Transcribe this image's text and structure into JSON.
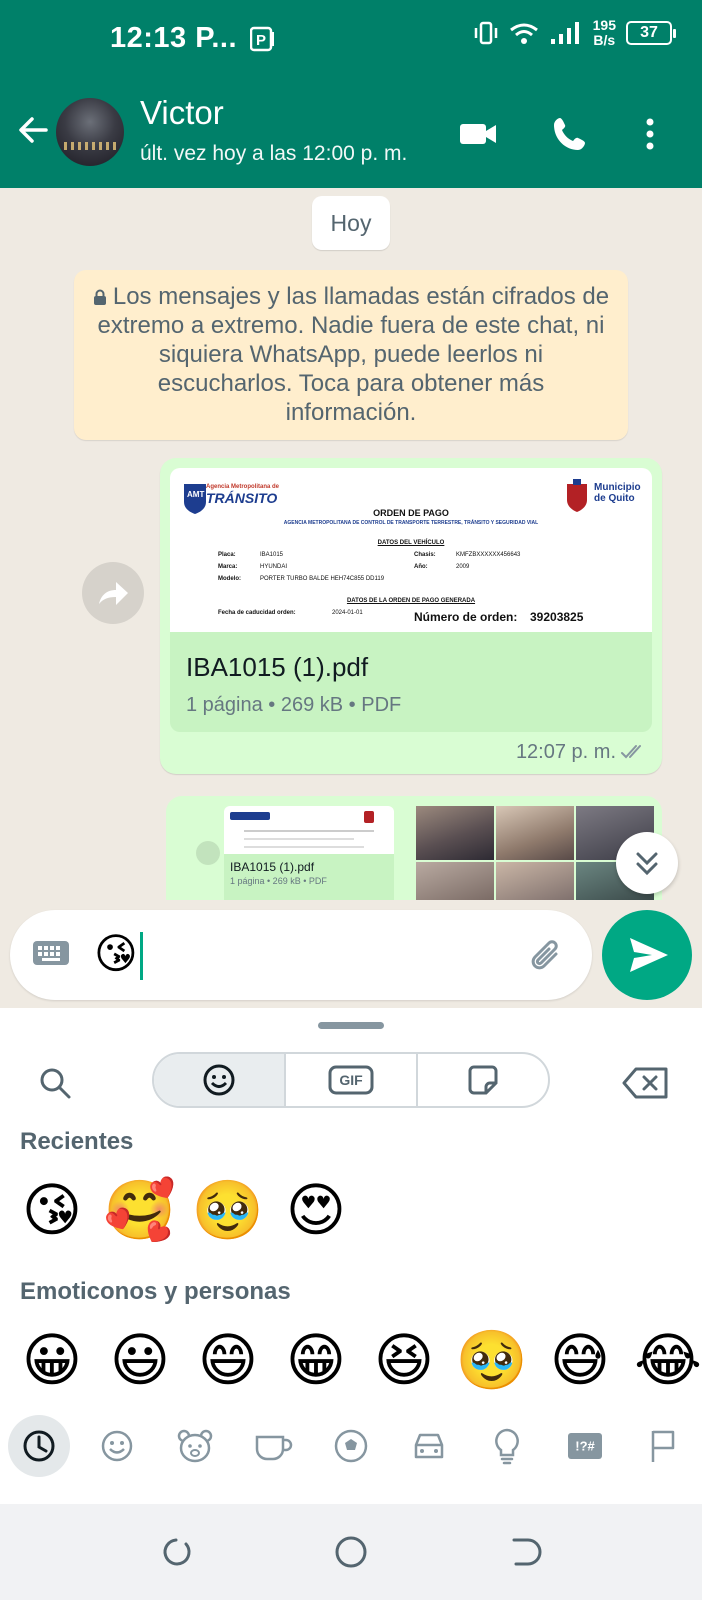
{
  "status_bar": {
    "time": "12:13 P...",
    "net_speed_value": "195",
    "net_speed_unit": "B/s",
    "battery": "37"
  },
  "header": {
    "contact_name": "Victor",
    "last_seen": "últ. vez hoy a las 12:00 p. m."
  },
  "chat": {
    "date_label": "Hoy",
    "encryption_notice": "Los mensajes y las llamadas están cifrados de extremo a extremo. Nadie fuera de este chat, ni siquiera WhatsApp, puede leerlos ni escucharlos. Toca para obtener más información.",
    "document_message": {
      "file_name": "IBA1015 (1).pdf",
      "file_meta": "1 página • 269 kB • PDF",
      "time": "12:07 p. m.",
      "preview": {
        "agency_top": "Agencia Metropolitana de",
        "agency_name": "TRÁNSITO",
        "muni": "Municipio de Quito",
        "doc_title": "ORDEN DE PAGO",
        "doc_subtitle": "AGENCIA METROPOLITANA DE CONTROL DE TRANSPORTE TERRESTRE, TRÁNSITO Y SEGURIDAD VIAL",
        "vehicle_section": "DATOS DEL VEHÍCULO",
        "placa_label": "Placa:",
        "placa_value": "IBA1015",
        "chasis_label": "Chasis:",
        "chasis_value": "KMFZBXXXXXX456643",
        "marca_label": "Marca:",
        "marca_value": "HYUNDAI",
        "anio_label": "Año:",
        "anio_value": "2009",
        "modelo_label": "Modelo:",
        "modelo_value": "PORTER TURBO BALDE HEH74C855 DD119",
        "order_section": "DATOS DE LA ORDEN DE PAGO GENERADA",
        "expiry_label": "Fecha de caducidad orden:",
        "expiry_value": "2024-01-01",
        "order_label": "Número de orden:",
        "order_value": "39203825"
      }
    },
    "second_message": {
      "file_name": "IBA1015 (1).pdf",
      "file_meta": "1 página • 269 kB • PDF"
    }
  },
  "composer": {
    "typed_text": "😘"
  },
  "emoji_panel": {
    "tab_gif": "GIF",
    "recent_title": "Recientes",
    "recent": [
      "😘",
      "🥰",
      "🥹",
      "😍"
    ],
    "people_title": "Emoticonos y personas",
    "people": [
      "😀",
      "😃",
      "😄",
      "😁",
      "😆",
      "🥹",
      "😅",
      "😂"
    ],
    "category_icons": [
      "clock-icon",
      "smiley-icon",
      "bear-icon",
      "cup-icon",
      "soccer-ball-icon",
      "car-icon",
      "lightbulb-icon",
      "symbols-icon",
      "flag-icon"
    ],
    "symbols_label": "!?#"
  },
  "colors": {
    "brand": "#008069",
    "accent": "#00a884",
    "bubble_out": "#d9fdd3",
    "chat_bg": "#efeae2"
  }
}
